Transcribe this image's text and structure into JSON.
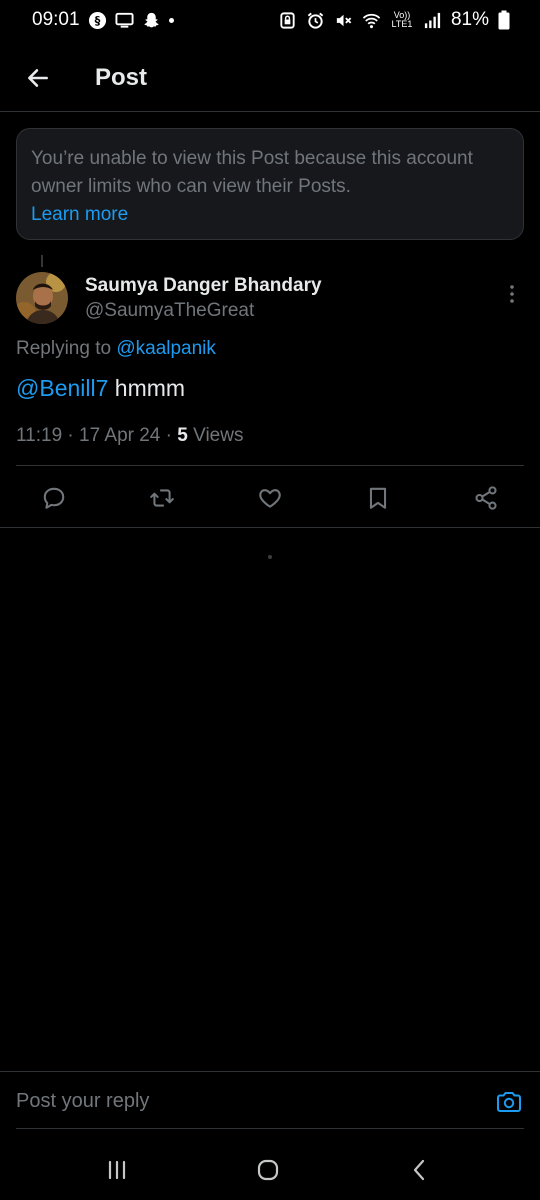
{
  "status_bar": {
    "time": "09:01",
    "left_icons": [
      "threads-icon",
      "screen-icon",
      "snapchat-icon"
    ],
    "right_icons": [
      "lock-icon",
      "alarm-icon",
      "mute-icon",
      "wifi-icon",
      "volte-icon",
      "signal-icon"
    ],
    "network_label_top": "Vo))",
    "network_label_bottom": "LTE1",
    "battery": "81%"
  },
  "header": {
    "title": "Post",
    "back_icon": "arrow-left-icon"
  },
  "notice": {
    "text": "You’re unable to view this Post because this account owner limits who can view their Posts.",
    "link": "Learn more"
  },
  "post": {
    "author_name": "Saumya Danger Bhandary",
    "author_handle": "@SaumyaTheGreat",
    "replying_prefix": "Replying to ",
    "replying_handle": "@kaalpanik",
    "mention": "@Benill7",
    "text": " hmmm",
    "time": "11:19",
    "date": "17 Apr 24",
    "views_count": "5",
    "views_label": "Views",
    "meta_sep": " · "
  },
  "actions": [
    "reply-icon",
    "repost-icon",
    "like-icon",
    "bookmark-icon",
    "share-icon"
  ],
  "reply_bar": {
    "placeholder": "Post your reply"
  },
  "colors": {
    "background": "#000000",
    "accent": "#1d9bf0",
    "muted": "#71767b",
    "text": "#e7e9ea",
    "divider": "#2f3336"
  }
}
